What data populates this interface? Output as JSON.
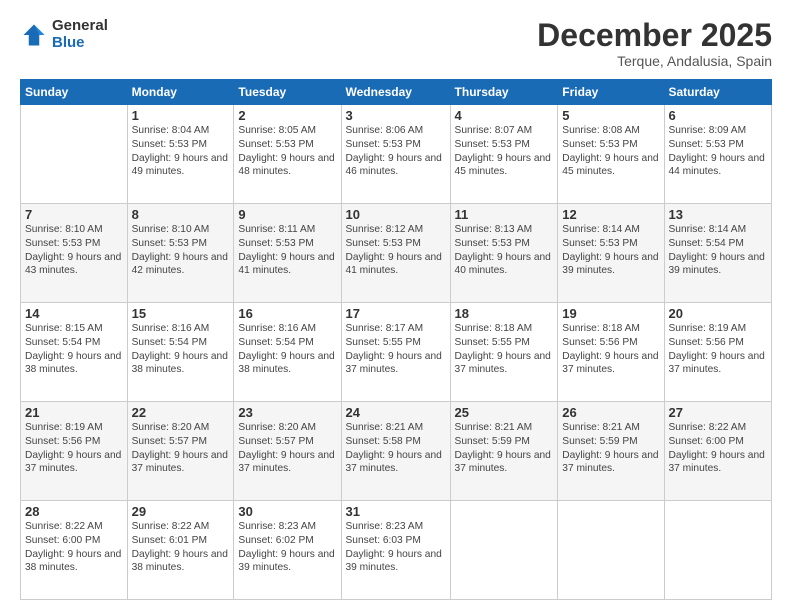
{
  "logo": {
    "general": "General",
    "blue": "Blue"
  },
  "header": {
    "month": "December 2025",
    "location": "Terque, Andalusia, Spain"
  },
  "weekdays": [
    "Sunday",
    "Monday",
    "Tuesday",
    "Wednesday",
    "Thursday",
    "Friday",
    "Saturday"
  ],
  "weeks": [
    [
      {
        "day": "",
        "info": ""
      },
      {
        "day": "1",
        "info": "Sunrise: 8:04 AM\nSunset: 5:53 PM\nDaylight: 9 hours\nand 49 minutes."
      },
      {
        "day": "2",
        "info": "Sunrise: 8:05 AM\nSunset: 5:53 PM\nDaylight: 9 hours\nand 48 minutes."
      },
      {
        "day": "3",
        "info": "Sunrise: 8:06 AM\nSunset: 5:53 PM\nDaylight: 9 hours\nand 46 minutes."
      },
      {
        "day": "4",
        "info": "Sunrise: 8:07 AM\nSunset: 5:53 PM\nDaylight: 9 hours\nand 45 minutes."
      },
      {
        "day": "5",
        "info": "Sunrise: 8:08 AM\nSunset: 5:53 PM\nDaylight: 9 hours\nand 45 minutes."
      },
      {
        "day": "6",
        "info": "Sunrise: 8:09 AM\nSunset: 5:53 PM\nDaylight: 9 hours\nand 44 minutes."
      }
    ],
    [
      {
        "day": "7",
        "info": "Sunrise: 8:10 AM\nSunset: 5:53 PM\nDaylight: 9 hours\nand 43 minutes."
      },
      {
        "day": "8",
        "info": "Sunrise: 8:10 AM\nSunset: 5:53 PM\nDaylight: 9 hours\nand 42 minutes."
      },
      {
        "day": "9",
        "info": "Sunrise: 8:11 AM\nSunset: 5:53 PM\nDaylight: 9 hours\nand 41 minutes."
      },
      {
        "day": "10",
        "info": "Sunrise: 8:12 AM\nSunset: 5:53 PM\nDaylight: 9 hours\nand 41 minutes."
      },
      {
        "day": "11",
        "info": "Sunrise: 8:13 AM\nSunset: 5:53 PM\nDaylight: 9 hours\nand 40 minutes."
      },
      {
        "day": "12",
        "info": "Sunrise: 8:14 AM\nSunset: 5:53 PM\nDaylight: 9 hours\nand 39 minutes."
      },
      {
        "day": "13",
        "info": "Sunrise: 8:14 AM\nSunset: 5:54 PM\nDaylight: 9 hours\nand 39 minutes."
      }
    ],
    [
      {
        "day": "14",
        "info": "Sunrise: 8:15 AM\nSunset: 5:54 PM\nDaylight: 9 hours\nand 38 minutes."
      },
      {
        "day": "15",
        "info": "Sunrise: 8:16 AM\nSunset: 5:54 PM\nDaylight: 9 hours\nand 38 minutes."
      },
      {
        "day": "16",
        "info": "Sunrise: 8:16 AM\nSunset: 5:54 PM\nDaylight: 9 hours\nand 38 minutes."
      },
      {
        "day": "17",
        "info": "Sunrise: 8:17 AM\nSunset: 5:55 PM\nDaylight: 9 hours\nand 37 minutes."
      },
      {
        "day": "18",
        "info": "Sunrise: 8:18 AM\nSunset: 5:55 PM\nDaylight: 9 hours\nand 37 minutes."
      },
      {
        "day": "19",
        "info": "Sunrise: 8:18 AM\nSunset: 5:56 PM\nDaylight: 9 hours\nand 37 minutes."
      },
      {
        "day": "20",
        "info": "Sunrise: 8:19 AM\nSunset: 5:56 PM\nDaylight: 9 hours\nand 37 minutes."
      }
    ],
    [
      {
        "day": "21",
        "info": "Sunrise: 8:19 AM\nSunset: 5:56 PM\nDaylight: 9 hours\nand 37 minutes."
      },
      {
        "day": "22",
        "info": "Sunrise: 8:20 AM\nSunset: 5:57 PM\nDaylight: 9 hours\nand 37 minutes."
      },
      {
        "day": "23",
        "info": "Sunrise: 8:20 AM\nSunset: 5:57 PM\nDaylight: 9 hours\nand 37 minutes."
      },
      {
        "day": "24",
        "info": "Sunrise: 8:21 AM\nSunset: 5:58 PM\nDaylight: 9 hours\nand 37 minutes."
      },
      {
        "day": "25",
        "info": "Sunrise: 8:21 AM\nSunset: 5:59 PM\nDaylight: 9 hours\nand 37 minutes."
      },
      {
        "day": "26",
        "info": "Sunrise: 8:21 AM\nSunset: 5:59 PM\nDaylight: 9 hours\nand 37 minutes."
      },
      {
        "day": "27",
        "info": "Sunrise: 8:22 AM\nSunset: 6:00 PM\nDaylight: 9 hours\nand 37 minutes."
      }
    ],
    [
      {
        "day": "28",
        "info": "Sunrise: 8:22 AM\nSunset: 6:00 PM\nDaylight: 9 hours\nand 38 minutes."
      },
      {
        "day": "29",
        "info": "Sunrise: 8:22 AM\nSunset: 6:01 PM\nDaylight: 9 hours\nand 38 minutes."
      },
      {
        "day": "30",
        "info": "Sunrise: 8:23 AM\nSunset: 6:02 PM\nDaylight: 9 hours\nand 39 minutes."
      },
      {
        "day": "31",
        "info": "Sunrise: 8:23 AM\nSunset: 6:03 PM\nDaylight: 9 hours\nand 39 minutes."
      },
      {
        "day": "",
        "info": ""
      },
      {
        "day": "",
        "info": ""
      },
      {
        "day": "",
        "info": ""
      }
    ]
  ]
}
